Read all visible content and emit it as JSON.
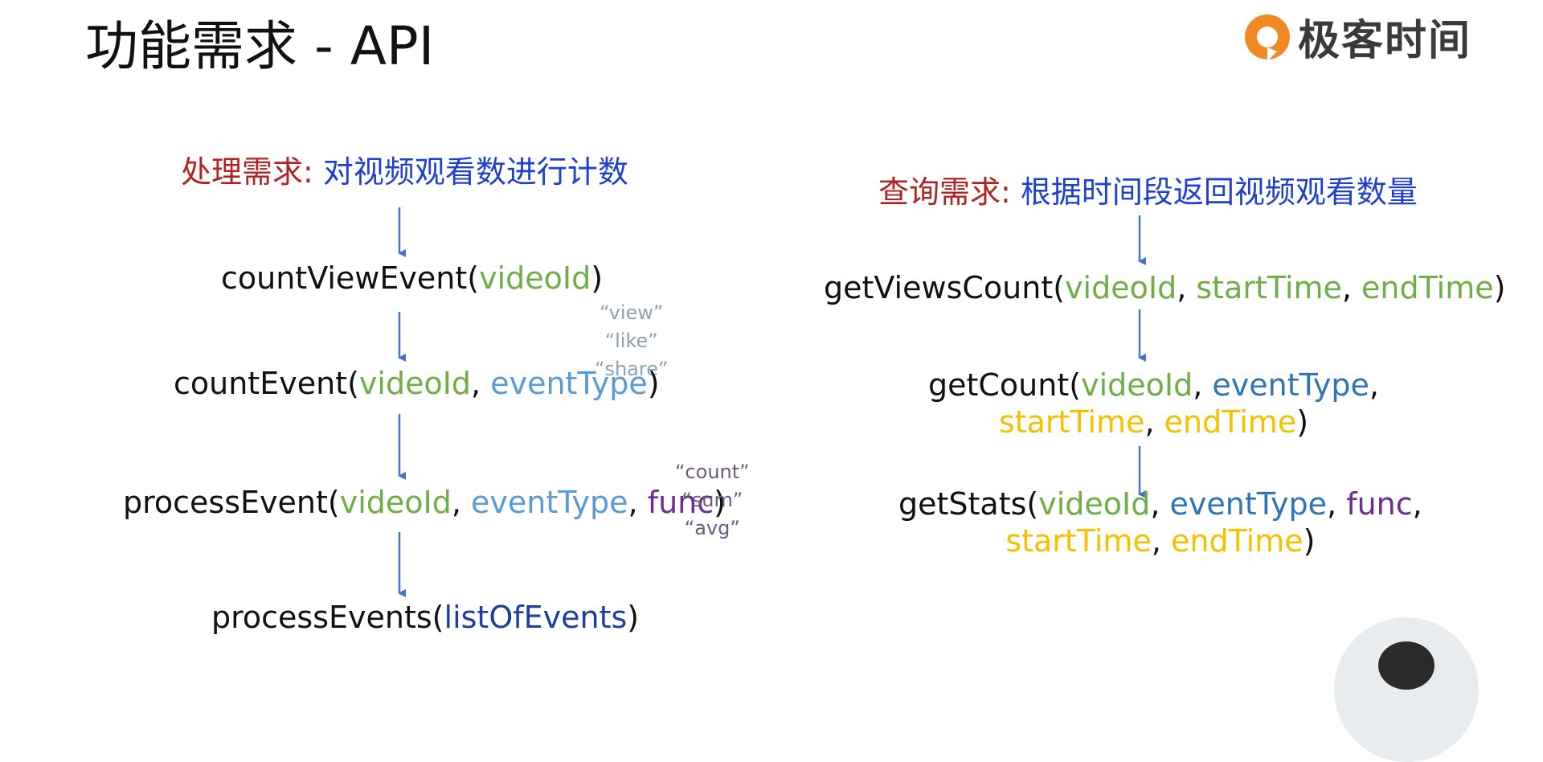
{
  "title": "功能需求 - API",
  "logo": {
    "text": "极客时间",
    "icon": "geektime-logo-icon",
    "color": "#f08a24"
  },
  "left": {
    "req_label": "处理需求:",
    "req_text": " 对视频观看数进行计数",
    "api1": {
      "name": "countViewEvent(",
      "p1": "videoId",
      "close": ")"
    },
    "api2": {
      "name": "countEvent(",
      "p1": "videoId",
      "sep1": ", ",
      "p2": "eventType",
      "close": ")"
    },
    "api3": {
      "name": "processEvent(",
      "p1": "videoId",
      "sep1": ", ",
      "p2": "eventType",
      "sep2": ", ",
      "p3": "func",
      "close": ")"
    },
    "api4": {
      "name": "processEvents(",
      "p1": "listOfEvents",
      "close": ")"
    },
    "event_types": [
      "“view”",
      "“like”",
      "“share”"
    ],
    "funcs": [
      "“count”",
      "“sum”",
      "“avg”"
    ]
  },
  "right": {
    "req_label": "查询需求:",
    "req_text": " 根据时间段返回视频观看数量",
    "api1": {
      "name": "getViewsCount(",
      "p1": "videoId",
      "sep1": ", ",
      "p2": "startTime",
      "sep2": ", ",
      "p3": "endTime",
      "close": ")"
    },
    "api2": {
      "name": "getCount(",
      "p1": "videoId",
      "sep1": ", ",
      "p2": "eventType",
      "sep2": ",",
      "p3": "startTime",
      "sep3": ", ",
      "p4": "endTime",
      "close": ")"
    },
    "api3": {
      "name": "getStats(",
      "p1": "videoId",
      "sep1": ", ",
      "p2": "eventType",
      "sep2": ", ",
      "p3": "func",
      "sep3": ",",
      "p4": "startTime",
      "sep4": ", ",
      "p5": "endTime",
      "close": ")"
    }
  },
  "colors": {
    "arrow": "#4472c4",
    "req_label": "#b22222",
    "req_text": "#1f3fd0"
  }
}
